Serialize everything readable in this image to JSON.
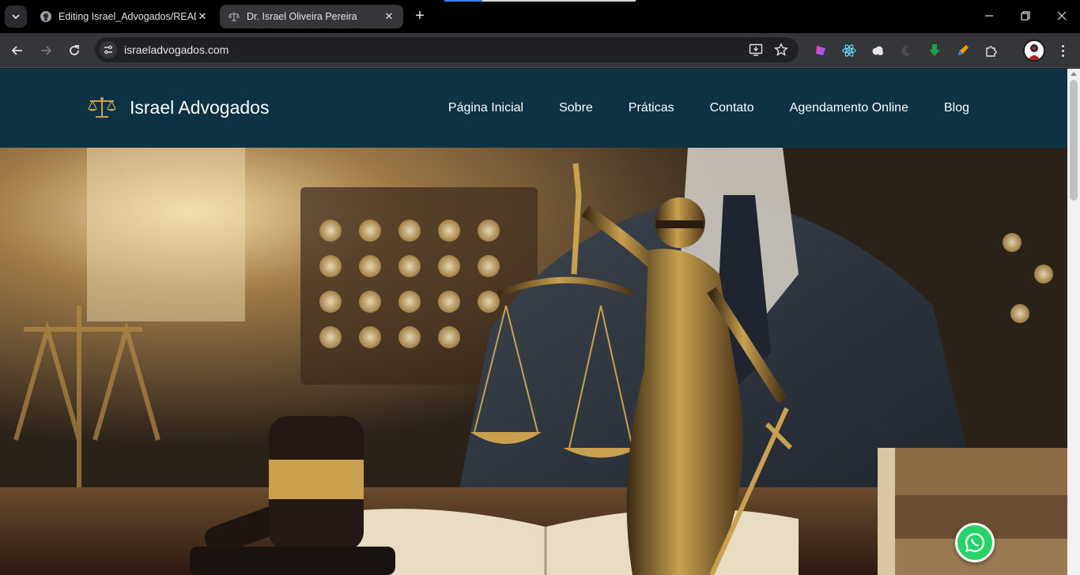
{
  "browser": {
    "tabs": [
      {
        "title": "Editing Israel_Advogados/READI",
        "favicon": "github-icon",
        "active": false
      },
      {
        "title": "Dr. Israel Oliveira Pereira",
        "favicon": "scales-icon",
        "active": true
      }
    ],
    "url": "israeladvogados.com",
    "extensions": [
      "purple-extension-icon",
      "react-devtools-icon",
      "cloud-extension-icon",
      "moon-extension-icon",
      "green-arrow-extension-icon",
      "pen-extension-icon",
      "puzzle-extensions-icon"
    ]
  },
  "site": {
    "brand": "Israel Advogados",
    "nav": [
      "Página Inicial",
      "Sobre",
      "Práticas",
      "Contato",
      "Agendamento Online",
      "Blog"
    ],
    "hero_alt": "Lady Justice statue with scales and gavel"
  },
  "colors": {
    "header_bg": "#0c3244",
    "accent_gold": "#c9a24a",
    "whatsapp": "#25d366"
  }
}
